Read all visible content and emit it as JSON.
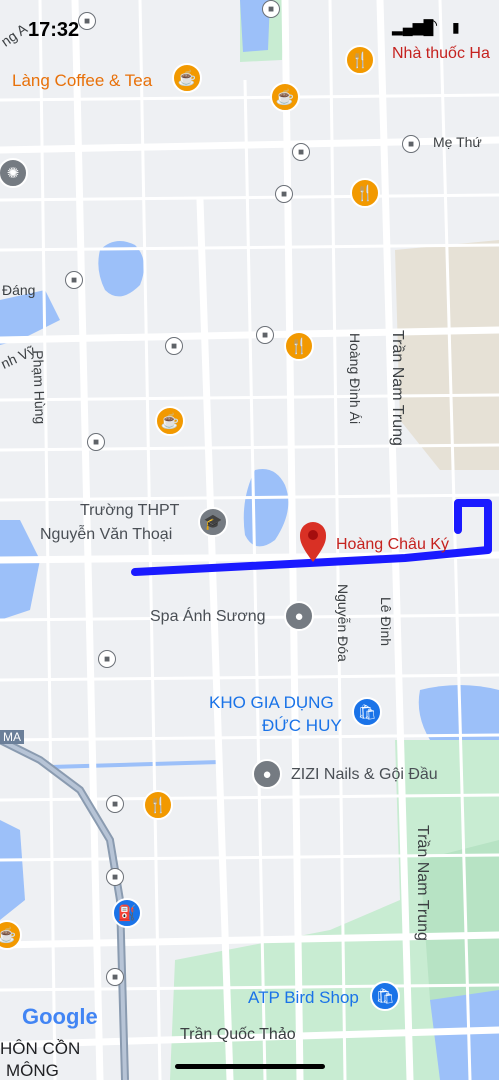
{
  "status_bar": {
    "time": "17:32"
  },
  "streets": {
    "me_thu": "Mẹ Thứ",
    "pham_hung": "Phạm Hùng",
    "hoang_dinh_ai": "Hoàng Đình Ái",
    "tran_nam_trung_1": "Trần Nam Trung",
    "tran_nam_trung_2": "Trần Nam Trung",
    "nguyen_doa": "Nguyễn Đóa",
    "le_dinh": "Lê Đình",
    "tran_quoc_thao": "Trần Quốc Thảo",
    "dang": "Đáng",
    "nh_vy": "nh Vỹ",
    "ng_a": "ng A",
    "ma": "MA"
  },
  "places": {
    "nha_thuoc": "Nhà thuốc Ha",
    "lang_coffee": "Làng Coffee & Tea",
    "truong_line1": "Trường THPT",
    "truong_line2": "Nguyễn Văn Thoại",
    "hoang_chau_ky": "Hoàng Châu Ký",
    "spa": "Spa Ánh Sương",
    "kho_line1": "KHO GIA DỤNG",
    "kho_line2": "ĐỨC HUY",
    "zizi": "ZIZI Nails & Gội Đầu",
    "atp": "ATP Bird Shop",
    "thon_con_1": "HÔN CỒN",
    "thon_con_2": "MÔNG"
  },
  "google_logo": "Google",
  "colors": {
    "route": "#1a1aff",
    "water": "#9cc0f9",
    "park": "#c8ecd2",
    "road": "#ffffff",
    "pin_red": "#d93025"
  }
}
